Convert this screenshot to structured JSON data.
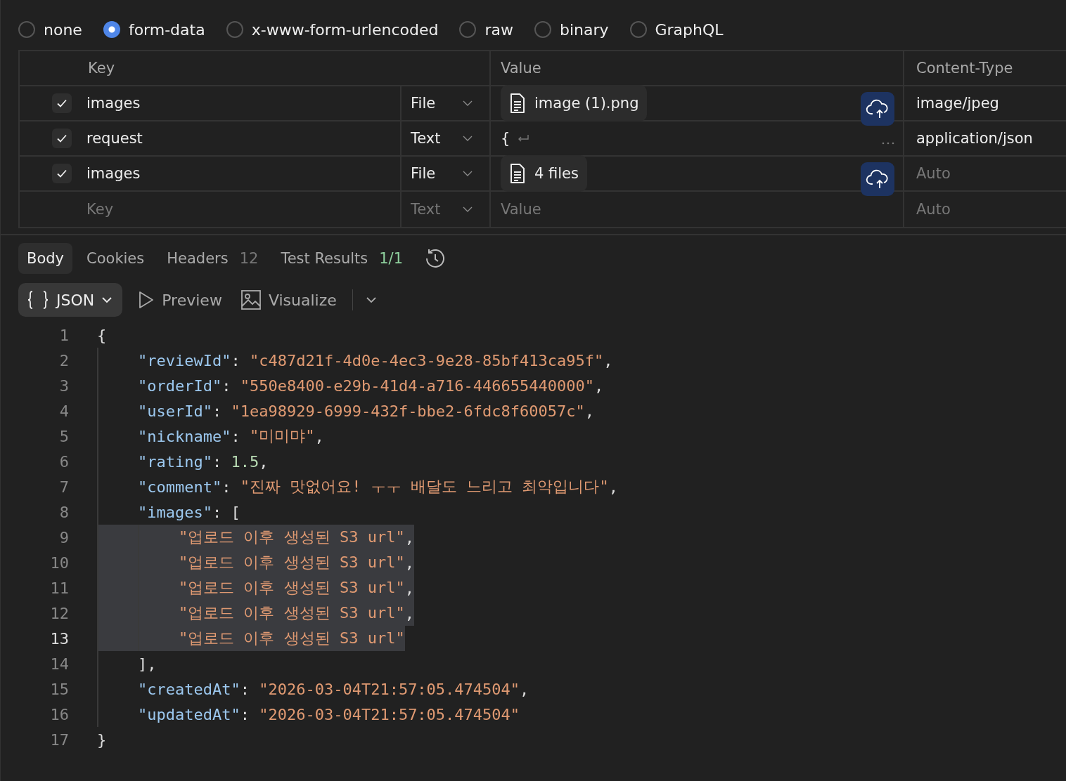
{
  "body_types": [
    {
      "label": "none",
      "selected": false
    },
    {
      "label": "form-data",
      "selected": true
    },
    {
      "label": "x-www-form-urlencoded",
      "selected": false
    },
    {
      "label": "raw",
      "selected": false
    },
    {
      "label": "binary",
      "selected": false
    },
    {
      "label": "GraphQL",
      "selected": false
    }
  ],
  "form_table": {
    "columns": [
      "Key",
      "Value",
      "Content-Type"
    ],
    "rows": [
      {
        "kind": "file",
        "checked": true,
        "key": "images",
        "type": "File",
        "value": "image (1).png",
        "content_type": "image/jpeg"
      },
      {
        "kind": "text",
        "checked": true,
        "key": "request",
        "type": "Text",
        "value": "{",
        "content_type": "application/json"
      },
      {
        "kind": "file",
        "checked": true,
        "key": "images",
        "type": "File",
        "value": "4 files",
        "content_type_placeholder": "Auto"
      },
      {
        "kind": "new",
        "key_placeholder": "Key",
        "type": "Text",
        "value_placeholder": "Value",
        "content_type_placeholder": "Auto"
      }
    ]
  },
  "response_tabs": [
    {
      "label": "Body",
      "selected": true
    },
    {
      "label": "Cookies",
      "selected": false
    },
    {
      "label": "Headers",
      "selected": false,
      "count": "12",
      "count_ok": false
    },
    {
      "label": "Test Results",
      "selected": false,
      "count": "1/1",
      "count_ok": true
    }
  ],
  "view": {
    "format": "JSON",
    "preview": "Preview",
    "visualize": "Visualize"
  },
  "code": [
    {
      "n": "1",
      "selected": false,
      "tokens": [
        {
          "kind": "punct",
          "text": "{"
        }
      ]
    },
    {
      "n": "2",
      "selected": false,
      "tokens": [
        {
          "kind": "key",
          "text": "\"reviewId\""
        },
        {
          "kind": "punct",
          "text": ": "
        },
        {
          "kind": "str",
          "text": "\"c487d21f-4d0e-4ec3-9e28-85bf413ca95f\""
        },
        {
          "kind": "punct",
          "text": ","
        }
      ]
    },
    {
      "n": "3",
      "selected": false,
      "tokens": [
        {
          "kind": "key",
          "text": "\"orderId\""
        },
        {
          "kind": "punct",
          "text": ": "
        },
        {
          "kind": "str",
          "text": "\"550e8400-e29b-41d4-a716-446655440000\""
        },
        {
          "kind": "punct",
          "text": ","
        }
      ]
    },
    {
      "n": "4",
      "selected": false,
      "tokens": [
        {
          "kind": "key",
          "text": "\"userId\""
        },
        {
          "kind": "punct",
          "text": ": "
        },
        {
          "kind": "str",
          "text": "\"1ea98929-6999-432f-bbe2-6fdc8f60057c\""
        },
        {
          "kind": "punct",
          "text": ","
        }
      ]
    },
    {
      "n": "5",
      "selected": false,
      "tokens": [
        {
          "kind": "key",
          "text": "\"nickname\""
        },
        {
          "kind": "punct",
          "text": ": "
        },
        {
          "kind": "str",
          "text": "\"미미먀\""
        },
        {
          "kind": "punct",
          "text": ","
        }
      ]
    },
    {
      "n": "6",
      "selected": false,
      "tokens": [
        {
          "kind": "key",
          "text": "\"rating\""
        },
        {
          "kind": "punct",
          "text": ": "
        },
        {
          "kind": "num",
          "text": "1.5"
        },
        {
          "kind": "punct",
          "text": ","
        }
      ]
    },
    {
      "n": "7",
      "selected": false,
      "tokens": [
        {
          "kind": "key",
          "text": "\"comment\""
        },
        {
          "kind": "punct",
          "text": ": "
        },
        {
          "kind": "str",
          "text": "\"진짜 맛없어요! ㅜㅜ 배달도 느리고 최악입니다\""
        },
        {
          "kind": "punct",
          "text": ","
        }
      ]
    },
    {
      "n": "8",
      "selected": false,
      "tokens": [
        {
          "kind": "key",
          "text": "\"images\""
        },
        {
          "kind": "punct",
          "text": ": ["
        }
      ]
    },
    {
      "n": "9",
      "selected": true,
      "tokens": [
        {
          "kind": "str",
          "text": "\"업로드 이후 생성된 S3 url\""
        },
        {
          "kind": "punct",
          "text": ","
        }
      ]
    },
    {
      "n": "10",
      "selected": true,
      "tokens": [
        {
          "kind": "str",
          "text": "\"업로드 이후 생성된 S3 url\""
        },
        {
          "kind": "punct",
          "text": ","
        }
      ]
    },
    {
      "n": "11",
      "selected": true,
      "tokens": [
        {
          "kind": "str",
          "text": "\"업로드 이후 생성된 S3 url\""
        },
        {
          "kind": "punct",
          "text": ","
        }
      ]
    },
    {
      "n": "12",
      "selected": true,
      "tokens": [
        {
          "kind": "str",
          "text": "\"업로드 이후 생성된 S3 url\""
        },
        {
          "kind": "punct",
          "text": ","
        }
      ]
    },
    {
      "n": "13",
      "selected": true,
      "tokens": [
        {
          "kind": "str",
          "text": "\"업로드 이후 생성된 S3 url\""
        }
      ]
    },
    {
      "n": "14",
      "selected": false,
      "tokens": [
        {
          "kind": "punct",
          "text": "],"
        }
      ]
    },
    {
      "n": "15",
      "selected": false,
      "tokens": [
        {
          "kind": "key",
          "text": "\"createdAt\""
        },
        {
          "kind": "punct",
          "text": ": "
        },
        {
          "kind": "str",
          "text": "\"2026-03-04T21:57:05.474504\""
        },
        {
          "kind": "punct",
          "text": ","
        }
      ]
    },
    {
      "n": "16",
      "selected": false,
      "tokens": [
        {
          "kind": "key",
          "text": "\"updatedAt\""
        },
        {
          "kind": "punct",
          "text": ": "
        },
        {
          "kind": "str",
          "text": "\"2026-03-04T21:57:05.474504\""
        }
      ]
    },
    {
      "n": "17",
      "selected": false,
      "tokens": [
        {
          "kind": "punct",
          "text": "}"
        }
      ]
    }
  ]
}
